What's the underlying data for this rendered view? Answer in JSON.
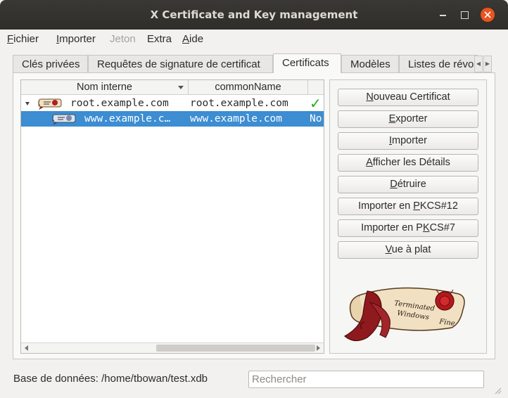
{
  "window": {
    "title": "X Certificate and Key management"
  },
  "menu": [
    {
      "pre": "",
      "ul": "F",
      "post": "ichier",
      "enabled": true
    },
    {
      "pre": "",
      "ul": "I",
      "post": "mporter",
      "enabled": true
    },
    {
      "pre": "",
      "ul": "",
      "post": "Jeton",
      "enabled": false
    },
    {
      "pre": "",
      "ul": "",
      "post": "Extra",
      "enabled": true
    },
    {
      "pre": "",
      "ul": "A",
      "post": "ide",
      "enabled": true
    }
  ],
  "tabs": [
    "Clés privées",
    "Requêtes de signature de certificat",
    "Certificats",
    "Modèles",
    "Listes de révo"
  ],
  "active_tab": "Certificats",
  "table": {
    "columns": [
      "Nom interne",
      "commonName",
      ""
    ],
    "rows": [
      {
        "name": "root.example.com",
        "cn": "root.example.com",
        "extra": "✓",
        "selected": false
      },
      {
        "name": "www.example.c…",
        "cn": "www.example.com",
        "extra": "No",
        "selected": true
      }
    ]
  },
  "buttons": [
    {
      "pre": "",
      "ul": "N",
      "post": "ouveau Certificat"
    },
    {
      "pre": "",
      "ul": "E",
      "post": "xporter"
    },
    {
      "pre": "",
      "ul": "I",
      "post": "mporter"
    },
    {
      "pre": "",
      "ul": "A",
      "post": "fficher les Détails"
    },
    {
      "pre": "",
      "ul": "D",
      "post": "étruire"
    },
    {
      "pre": "Importer en ",
      "ul": "P",
      "post": "KCS#12"
    },
    {
      "pre": "Importer en P",
      "ul": "K",
      "post": "CS#7"
    },
    {
      "pre": "",
      "ul": "V",
      "post": "ue à plat"
    }
  ],
  "status": {
    "database": "Base de données: /home/tbowan/test.xdb"
  },
  "search": {
    "placeholder": "Rechercher"
  },
  "logo": {
    "lines": [
      "Terminated",
      "Windows"
    ],
    "fine": "Fine"
  },
  "colors": {
    "selection": "#3c8dd2",
    "check": "#1faa14",
    "close": "#e95420"
  }
}
